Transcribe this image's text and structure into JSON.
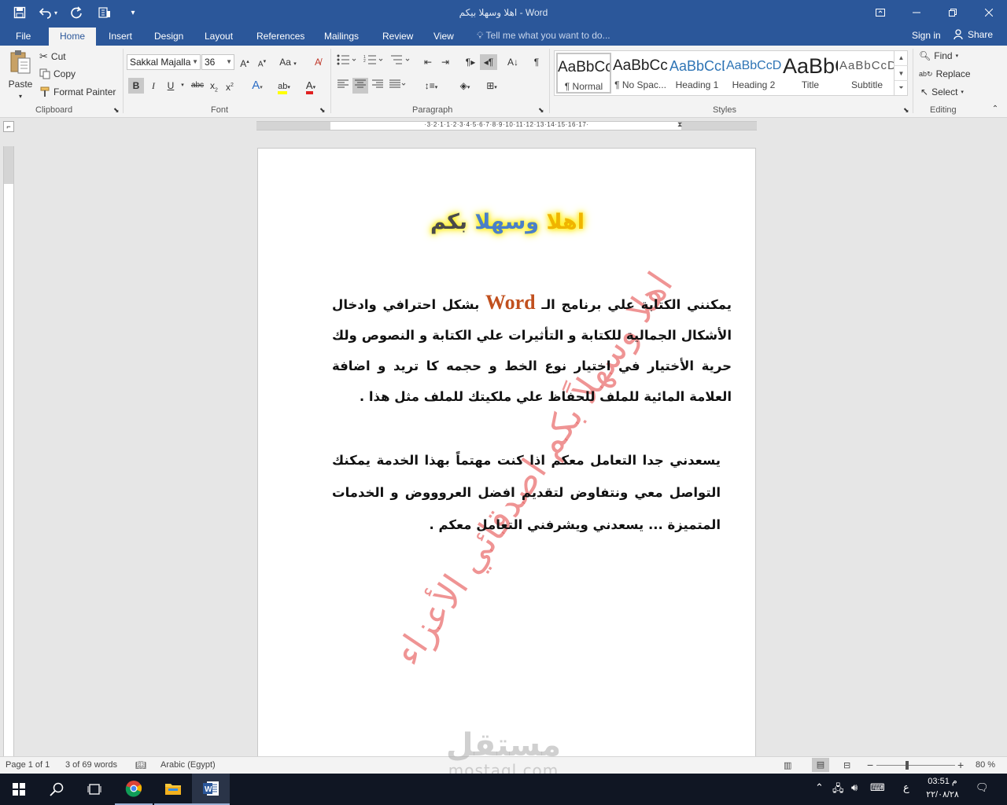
{
  "window": {
    "title": "اهلا وسهلا بيكم - Word",
    "controls": [
      "ribbon-display-icon",
      "minimize-icon",
      "restore-icon",
      "close-icon"
    ]
  },
  "qat": {
    "items": [
      "save-icon",
      "undo-icon",
      "redo-icon",
      "touch-mode-icon",
      "customize-qat-icon"
    ]
  },
  "tabs": [
    {
      "label": "File"
    },
    {
      "label": "Home",
      "active": true
    },
    {
      "label": "Insert"
    },
    {
      "label": "Design"
    },
    {
      "label": "Layout"
    },
    {
      "label": "References"
    },
    {
      "label": "Mailings"
    },
    {
      "label": "Review"
    },
    {
      "label": "View"
    }
  ],
  "tell_me": "Tell me what you want to do...",
  "sign_in": "Sign in",
  "share": "Share",
  "clipboard": {
    "paste": "Paste",
    "cut": "Cut",
    "copy": "Copy",
    "format_painter": "Format Painter",
    "group": "Clipboard"
  },
  "font": {
    "name": "Sakkal Majalla",
    "size": "36",
    "group": "Font"
  },
  "paragraph": {
    "group": "Paragraph"
  },
  "styles": {
    "group": "Styles",
    "items": [
      {
        "preview": "AaBbCcDdEe",
        "name": "¶ Normal",
        "color": "#000000"
      },
      {
        "preview": "AaBbCcDdEe",
        "name": "¶ No Spac...",
        "color": "#000000"
      },
      {
        "preview": "AaBbCcDdEe",
        "name": "Heading 1",
        "color": "#2e74b5"
      },
      {
        "preview": "AaBbCcDdEe",
        "name": "Heading 2",
        "color": "#2e74b5"
      },
      {
        "preview": "AaBbCcDdEe",
        "name": "Title",
        "color": "#000000"
      },
      {
        "preview": "AaBbCcDdEe",
        "name": "Subtitle",
        "color": "#595959"
      }
    ]
  },
  "editing": {
    "find": "Find",
    "replace": "Replace",
    "select": "Select",
    "group": "Editing"
  },
  "ruler": {
    "numbers": "·3·2·1·1·2·3·4·5·6·7·8·9·10·11·12·13·14·15·16·17·"
  },
  "document": {
    "title_word1": "اهلا",
    "title_word2": "وسهلا",
    "title_word3": "بكم",
    "para1_before": "يمكنني الكتابة علي برنامج الـ ",
    "para1_word": "Word",
    "para1_after": " بشكل احترافي وادخال الأشكال الجمالية للكتابة و التأثيرات علي الكتابة و النصوص ولك حرية الأختيار في اختيار نوع الخط و حجمه كا تريد و  اضافة العلامة المائية للملف للحفاظ علي ملكيتك للملف مثل هذا .",
    "para2": "يسعدني جدا التعامل معكم اذا كنت مهتماً بهذا الخدمة يمكنك التواصل معي ونتفاوض لتقديم افضل العروووض و الخدمات المتميزة ... يسعدني ويشرفني التعامل معكم .",
    "watermark": "اهلا وسهلاً بكم اصدقائي الأعزاء"
  },
  "status": {
    "page": "Page 1 of 1",
    "words": "3 of 69 words",
    "language": "Arabic (Egypt)",
    "zoom": "80 %",
    "zoom_percent": 80
  },
  "logo": {
    "line1": "مستقل",
    "line2": "mostaql.com"
  },
  "taskbar": {
    "apps": [
      "start-icon",
      "search-icon",
      "task-view-icon",
      "chrome-icon",
      "file-explorer-icon",
      "word-icon"
    ],
    "clock_time": "03:51 م",
    "clock_date": "٢٢/٠٨/٢٨",
    "input_lang": "ع"
  }
}
